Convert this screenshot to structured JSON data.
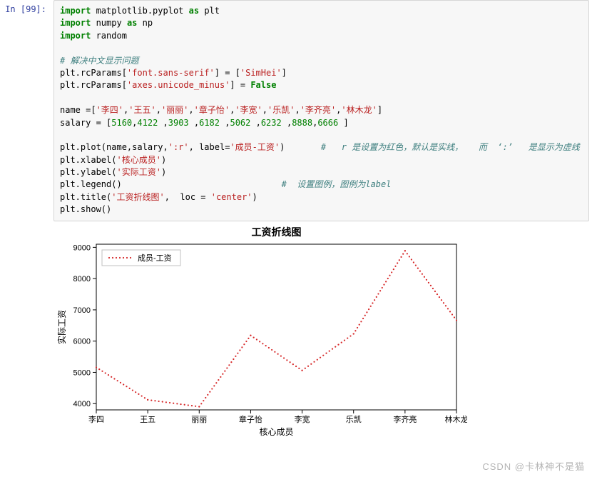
{
  "cell": {
    "prompt": "In  [99]:",
    "code": {
      "l1_kw": "import",
      "l1_mod": " matplotlib.pyplot ",
      "l1_as": "as",
      "l1_alias": " plt",
      "l2_kw": "import",
      "l2_mod": " numpy ",
      "l2_as": "as",
      "l2_alias": " np",
      "l3_kw": "import",
      "l3_mod": " random",
      "c1": "# 解决中文显示问题",
      "l5a": "plt.rcParams[",
      "l5s": "'font.sans-serif'",
      "l5b": "] = [",
      "l5s2": "'SimHei'",
      "l5c": "]",
      "l6a": "plt.rcParams[",
      "l6s": "'axes.unicode_minus'",
      "l6b": "] = ",
      "l6v": "False",
      "l8a": "name =[",
      "l8s1": "'李四'",
      "l8c": ",",
      "l8s2": "'王五'",
      "l8s3": "'丽丽'",
      "l8s4": "'章子怡'",
      "l8s5": "'李宽'",
      "l8s6": "'乐凯'",
      "l8s7": "'李齐亮'",
      "l8s8": "'林木龙'",
      "l8e": "]",
      "l9a": "salary = [",
      "l9n1": "5160",
      "l9n2": "4122",
      "l9n3": "3903",
      "l9n4": "6182",
      "l9n5": "5062",
      "l9n6": "6232",
      "l9n7": "8888",
      "l9n8": "6666",
      "l9e": " ]",
      "l11a": "plt.plot(name,salary,",
      "l11s1": "':r'",
      "l11b": ", label=",
      "l11s2": "'成员-工资'",
      "l11c": ")       ",
      "l11cm": "#   r 是设置为红色，默认是实线，   而  ‘:’   是显示为虚线",
      "l12a": "plt.xlabel(",
      "l12s": "'核心成员'",
      "l12b": ")",
      "l13a": "plt.ylabel(",
      "l13s": "'实际工资'",
      "l13b": ")",
      "l14a": "plt.legend()                               ",
      "l14cm": "#  设置图例，图例为label",
      "l15a": "plt.title(",
      "l15s": "'工资折线图'",
      "l15b": ",  loc = ",
      "l15s2": "'center'",
      "l15c": ")",
      "l16": "plt.show()"
    }
  },
  "chart_data": {
    "type": "line",
    "style": "dotted",
    "color": "#d62728",
    "title": "工资折线图",
    "xlabel": "核心成员",
    "ylabel": "实际工资",
    "categories": [
      "李四",
      "王五",
      "丽丽",
      "章子怡",
      "李宽",
      "乐凯",
      "李齐亮",
      "林木龙"
    ],
    "values": [
      5160,
      4122,
      3903,
      6182,
      5062,
      6232,
      8888,
      6666
    ],
    "yticks": [
      4000,
      5000,
      6000,
      7000,
      8000,
      9000
    ],
    "ylim": [
      3800,
      9100
    ],
    "legend": {
      "label": "成员-工资",
      "position": "upper-left"
    }
  },
  "watermark": "CSDN @卡林神不是猫"
}
